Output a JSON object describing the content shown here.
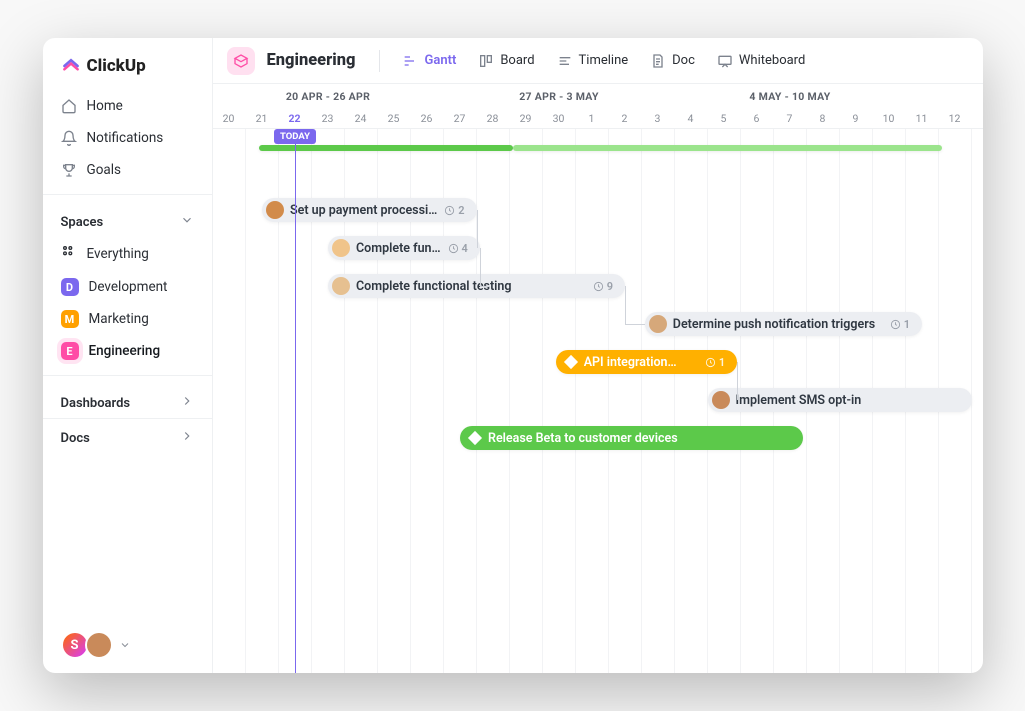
{
  "brand": "ClickUp",
  "nav": {
    "home": "Home",
    "notifications": "Notifications",
    "goals": "Goals"
  },
  "spaces": {
    "heading": "Spaces",
    "everything": "Everything",
    "items": [
      {
        "key": "D",
        "label": "Development",
        "color": "#7b68ee"
      },
      {
        "key": "M",
        "label": "Marketing",
        "color": "#ffa000"
      },
      {
        "key": "E",
        "label": "Engineering",
        "color": "#ff4da6",
        "active": true
      }
    ]
  },
  "sections": {
    "dashboards": "Dashboards",
    "docs": "Docs"
  },
  "header": {
    "space": "Engineering",
    "views": [
      {
        "label": "Gantt",
        "icon": "gantt-icon",
        "active": true
      },
      {
        "label": "Board",
        "icon": "board-icon"
      },
      {
        "label": "Timeline",
        "icon": "timeline-icon"
      },
      {
        "label": "Doc",
        "icon": "doc-icon"
      },
      {
        "label": "Whiteboard",
        "icon": "whiteboard-icon"
      }
    ]
  },
  "timeline": {
    "today_label": "TODAY",
    "today_index": 2,
    "day_width": 33,
    "weeks": [
      {
        "label": "20 APR - 26 APR",
        "span": 7
      },
      {
        "label": "27 APR - 3 MAY",
        "span": 7
      },
      {
        "label": "4 MAY - 10 MAY",
        "span": 7
      }
    ],
    "days": [
      "20",
      "21",
      "22",
      "23",
      "24",
      "25",
      "26",
      "27",
      "28",
      "29",
      "30",
      "1",
      "2",
      "3",
      "4",
      "5",
      "6",
      "7",
      "8",
      "9",
      "10",
      "11",
      "12"
    ]
  },
  "overall": {
    "start": 1.4,
    "segments": [
      {
        "len": 7.7,
        "color": "#5cc94a"
      },
      {
        "len": 13,
        "color": "#9be48c"
      }
    ]
  },
  "tasks": [
    {
      "row": 0,
      "start": 1.5,
      "len": 6.5,
      "label": "Set up payment processing",
      "avatar": "#d28b4a",
      "subtasks": "2"
    },
    {
      "row": 1,
      "start": 3.5,
      "len": 4.6,
      "label": "Complete functio…",
      "avatar": "#f0c48a",
      "subtasks": "4"
    },
    {
      "row": 2,
      "start": 3.5,
      "len": 9.0,
      "label": "Complete functional testing",
      "avatar": "#e6c090",
      "subtasks": "9"
    },
    {
      "row": 3,
      "start": 13.1,
      "len": 8.4,
      "label": "Determine push notification triggers",
      "avatar": "#d6a87a",
      "subtasks": "1"
    },
    {
      "row": 4,
      "start": 10.4,
      "len": 5.5,
      "label": "API integration…",
      "style": "yellow",
      "diamond": true,
      "subtasks": "1"
    },
    {
      "row": 5,
      "start": 15.0,
      "len": 8.0,
      "label": "Implement SMS opt-in",
      "avatar": "#c98a5a"
    },
    {
      "row": 6,
      "start": 7.5,
      "len": 10.4,
      "label": "Release Beta to customer devices",
      "style": "green",
      "diamond": true
    }
  ],
  "users": [
    {
      "initial": "S",
      "bg": "linear-gradient(135deg,#ff6a00,#d63aff)"
    },
    {
      "img": true,
      "bg": "#c98a5a"
    }
  ]
}
